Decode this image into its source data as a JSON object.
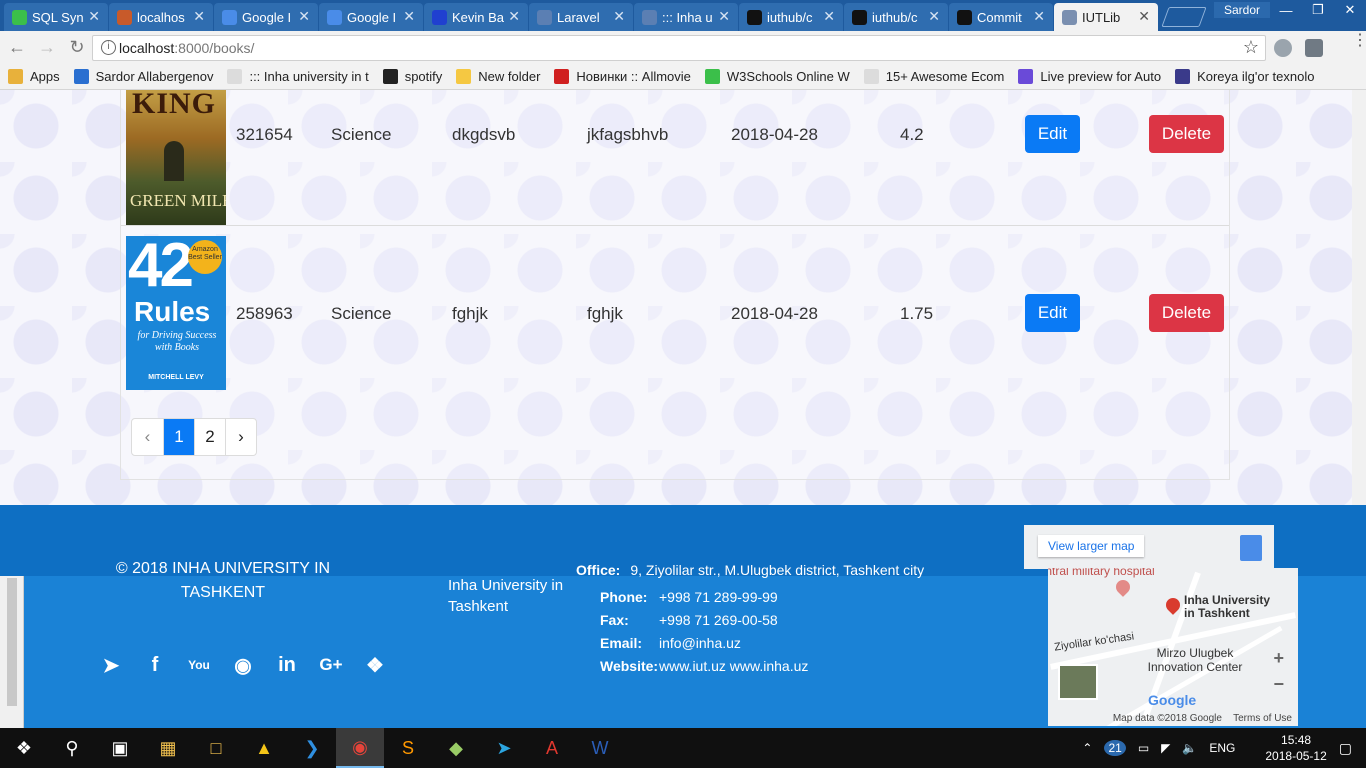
{
  "browser": {
    "tabs": [
      {
        "label": "SQL Syn",
        "color": "#3bbf4a",
        "active": false
      },
      {
        "label": "localhos",
        "color": "#c85a2a",
        "active": false
      },
      {
        "label": "Google I",
        "color": "#4a8ce8",
        "active": false
      },
      {
        "label": "Google I",
        "color": "#4a8ce8",
        "active": false
      },
      {
        "label": "Kevin Ba",
        "color": "#2040d0",
        "active": false
      },
      {
        "label": "Laravel",
        "color": "#5b7fb3",
        "active": false
      },
      {
        "label": "::: Inha u",
        "color": "#5b7fb3",
        "active": false
      },
      {
        "label": "iuthub/c",
        "color": "#111111",
        "active": false
      },
      {
        "label": "iuthub/c",
        "color": "#111111",
        "active": false
      },
      {
        "label": "Commit",
        "color": "#111111",
        "active": false
      },
      {
        "label": "IUTLib",
        "color": "#7a8fb0",
        "active": true
      }
    ],
    "user": "Sardor",
    "url_host": "localhost",
    "url_path": ":8000/books/",
    "bookmarks": [
      {
        "label": "Apps",
        "color": "#e8b13b"
      },
      {
        "label": "Sardor Allabergenov",
        "color": "#2a6fd0"
      },
      {
        "label": "::: Inha university in t",
        "color": "#dcdcdc"
      },
      {
        "label": "spotify",
        "color": "#222222"
      },
      {
        "label": "New folder",
        "color": "#f5c842"
      },
      {
        "label": "Новинки :: Allmovie",
        "color": "#d02020"
      },
      {
        "label": "W3Schools Online W",
        "color": "#3bbf4a"
      },
      {
        "label": "15+ Awesome Ecom",
        "color": "#dcdcdc"
      },
      {
        "label": "Live preview for Auto",
        "color": "#6a4ad8"
      },
      {
        "label": "Koreya ilg'or texnolo",
        "color": "#3a3a8a"
      }
    ]
  },
  "books": [
    {
      "isbn": "321654",
      "category": "Science",
      "title": "dkgdsvb",
      "author": "jkfagsbhvb",
      "date": "2018-04-28",
      "price": "4.2",
      "cover_top": "KING",
      "cover_bottom": "GREEN MILE"
    },
    {
      "isbn": "258963",
      "category": "Science",
      "title": "fghjk",
      "author": "fghjk",
      "date": "2018-04-28",
      "price": "1.75",
      "cover_top": "42",
      "cover_mid": "Rules",
      "cover_sub": "for Driving Success with Books",
      "cover_author": "MITCHELL LEVY",
      "cover_badge": "Amazon Best Seller"
    }
  ],
  "actions": {
    "edit": "Edit",
    "delete": "Delete"
  },
  "pagination": {
    "prev": "‹",
    "pages": [
      "1",
      "2"
    ],
    "current": "1",
    "next": "›"
  },
  "footer": {
    "copyright": "© 2018 INHA UNIVERSITY IN TASHKENT",
    "org": "Inha University in Tashkent",
    "office_label": "Office:",
    "office": "9, Ziyolilar str., M.Ulugbek district, Tashkent city",
    "phone_label": "Phone:",
    "phone": "+998 71 289-99-99",
    "fax_label": "Fax:",
    "fax": "+998 71 269-00-58",
    "email_label": "Email:",
    "email": "info@inha.uz",
    "website_label": "Website:",
    "website": "www.iut.uz www.inha.uz",
    "social": [
      "telegram-icon",
      "facebook-icon",
      "youtube-icon",
      "instagram-icon",
      "linkedin-icon",
      "google-plus-icon",
      "twitter-icon"
    ],
    "map": {
      "view_larger": "View larger map",
      "place": "Inha University in Tashkent",
      "place2": "Mirzo Ulugbek Innovation Center",
      "hospital": "Central military hospital",
      "street": "Ziyolilar ko'chasi",
      "credit": "Map data ©2018 Google",
      "terms": "Terms of Use"
    }
  },
  "taskbar": {
    "time": "15:48",
    "date": "2018-05-12",
    "lang": "ENG",
    "badge": "21"
  }
}
